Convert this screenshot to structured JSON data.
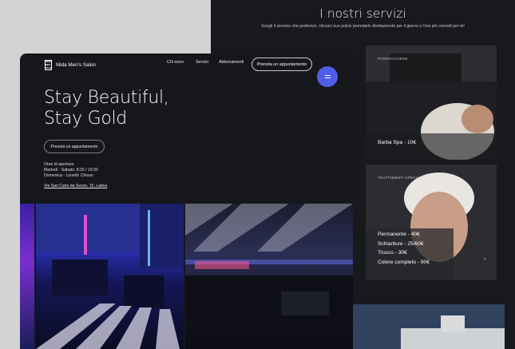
{
  "services": {
    "title": "I nostri servizi",
    "subtitle": "Scegli il servizio che preferisci, cliccaci sue potrai prenotarlo direttamente per il giorno e l'ora più comodi per te!",
    "cards": [
      {
        "label": "PARRUCCHIERE",
        "items": [
          "Barba Spa - 10€"
        ]
      },
      {
        "label": "TRATTAMENTI SPECIALI",
        "items": [
          "Permanente - 40€",
          "Schiariture - 25/60€",
          "Trucco - 30€",
          "Colore completo - 90€"
        ],
        "arrow": "›"
      }
    ]
  },
  "site": {
    "brand": "Mida Men's Salon",
    "logo_mark": "MIDA MEN'S SALON",
    "nav": [
      "Chi sono",
      "Servizi",
      "Abbonamenti"
    ],
    "cta": "Prenota un appuntamento",
    "hero_line1": "Stay Beautiful,",
    "hero_line2": "Stay Gold",
    "hero_button": "Prenota un appuntamento",
    "hours_title": "Orari di apertura",
    "hours_week": "Martedì - Sabato: 8:30 / 19:30",
    "hours_closed": "Domenica - Lunedì: Chiuso",
    "address": "Via San Carlo da Sezze, 15, Latina"
  },
  "colors": {
    "accent": "#4f5de8",
    "background": "#16171a"
  }
}
